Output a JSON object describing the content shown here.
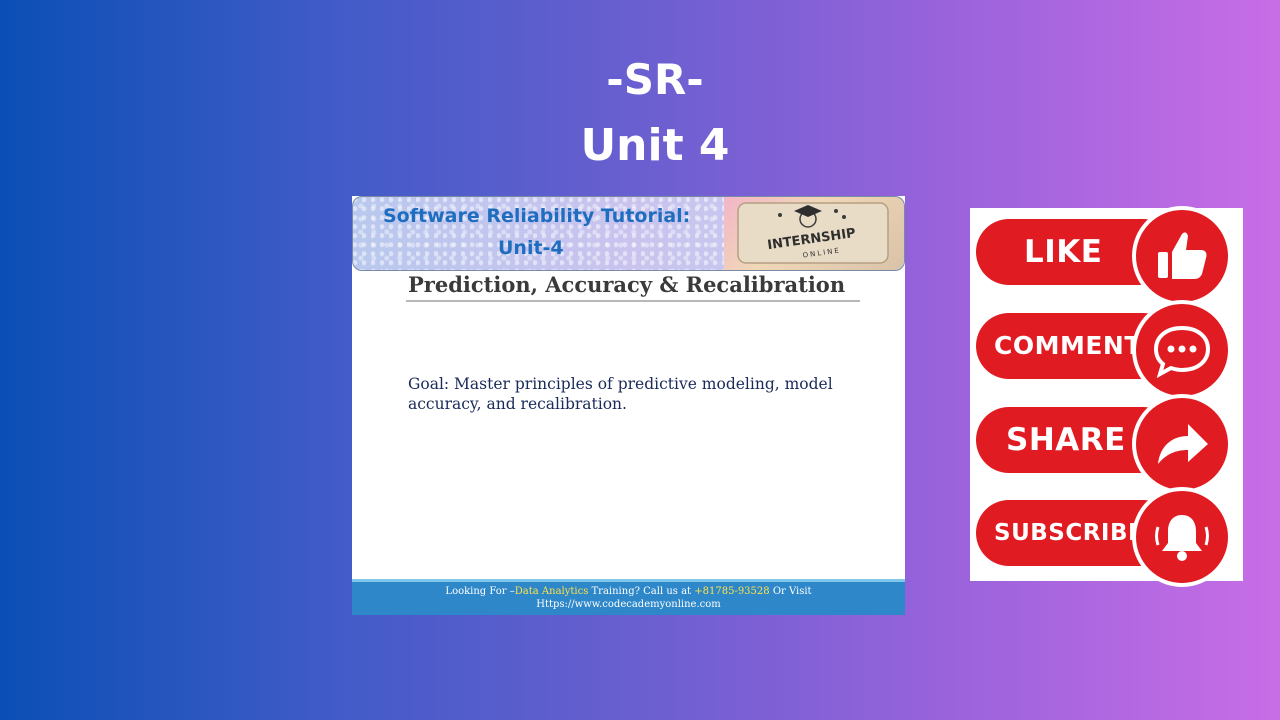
{
  "header": {
    "line1": "-SR-",
    "line2": "Unit 4"
  },
  "slide": {
    "banner_title_line1": "Software Reliability Tutorial:",
    "banner_title_line2": "Unit-4",
    "logo_text_1": "INTERNSHIP",
    "logo_text_2": "ONLINE",
    "heading": "Prediction, Accuracy & Recalibration",
    "goal_line1": "Goal: Master principles of predictive modeling, model",
    "goal_line2": "accuracy, and recalibration.",
    "footer": {
      "prefix": "Looking For –",
      "course": "Data Analytics",
      "middle": " Training? Call us at  ",
      "phone": "+81785-93528",
      "suffix": " Or Visit",
      "url": "Https://www.codecademyonline.com"
    }
  },
  "social": {
    "like_label": "LIKE",
    "comment_label": "COMMENT",
    "share_label": "SHARE",
    "subscribe_label": "SUBSCRIBE"
  },
  "colors": {
    "social_red": "#e11b22",
    "banner_text": "#1f6dbf",
    "footer_bg": "#2d87c9"
  }
}
